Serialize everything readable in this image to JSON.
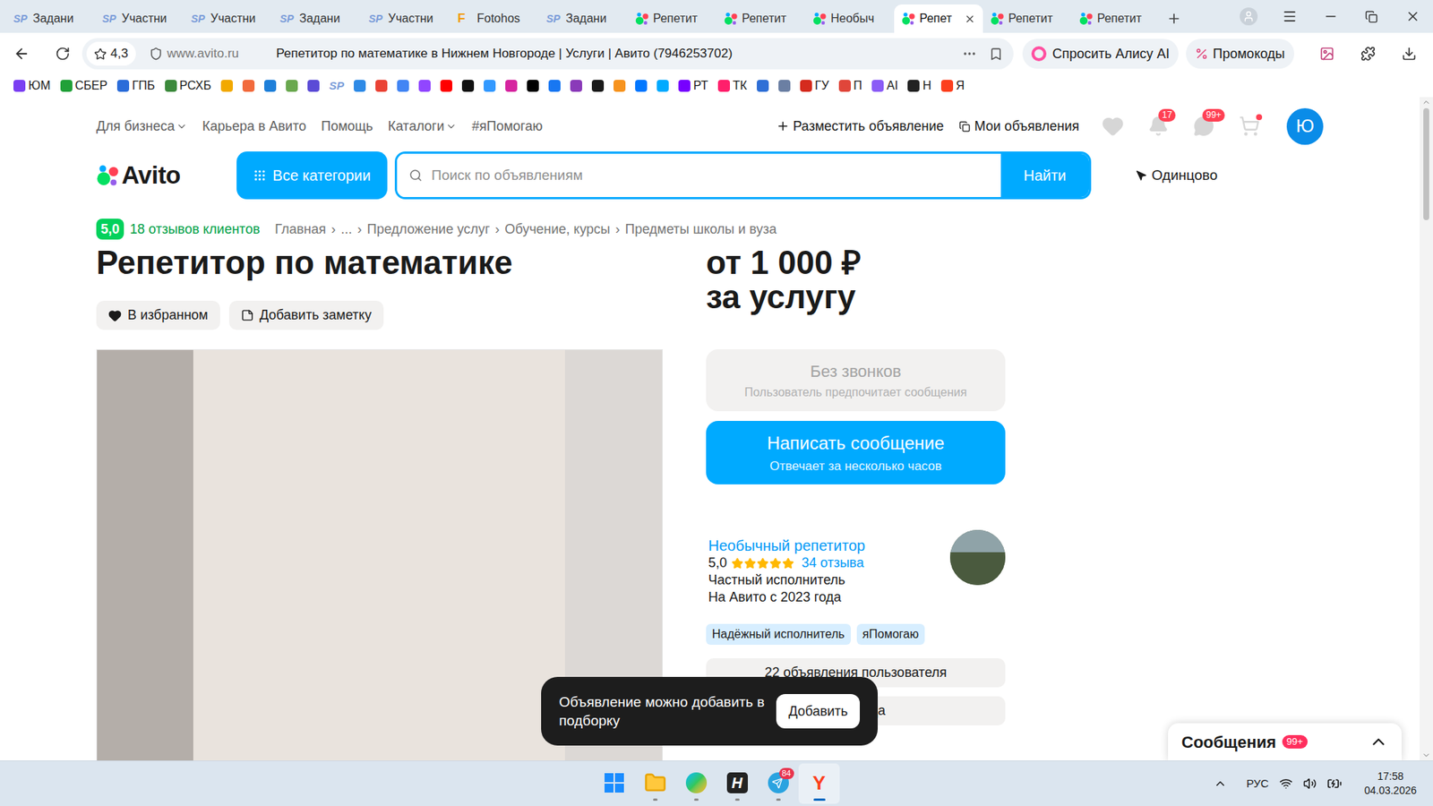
{
  "browser": {
    "tabs": [
      {
        "label": "Задани",
        "icon": "SP",
        "kind": "sp",
        "selected": false
      },
      {
        "label": "Участни",
        "icon": "SP",
        "kind": "sp",
        "selected": false
      },
      {
        "label": "Участни",
        "icon": "SP",
        "kind": "sp",
        "selected": false
      },
      {
        "label": "Задани",
        "icon": "SP",
        "kind": "sp",
        "selected": false
      },
      {
        "label": "Участни",
        "icon": "SP",
        "kind": "sp",
        "selected": false
      },
      {
        "label": "Fotohos",
        "icon": "F",
        "kind": "f",
        "selected": false
      },
      {
        "label": "Задани",
        "icon": "SP",
        "kind": "sp",
        "selected": false
      },
      {
        "label": "Репетит",
        "kind": "avito",
        "selected": false
      },
      {
        "label": "Репетит",
        "kind": "avito",
        "selected": false
      },
      {
        "label": "Необыч",
        "kind": "avito",
        "selected": false
      },
      {
        "label": "Репет",
        "kind": "avito",
        "selected": true
      },
      {
        "label": "Репетит",
        "kind": "avito",
        "selected": false
      },
      {
        "label": "Репетит",
        "kind": "avito",
        "selected": false
      }
    ],
    "address": {
      "rating": "4,3",
      "domain": "www.avito.ru",
      "title": "Репетитор по математике в Нижнем Новгороде | Услуги | Авито (7946253702)"
    },
    "alice": "Спросить Алису AI",
    "promo": "Промокоды",
    "bookmarks": [
      {
        "kind": "icon",
        "label": "ЮМ",
        "color": "#7b3ff2"
      },
      {
        "kind": "icon",
        "label": "СБЕР",
        "color": "#21a038"
      },
      {
        "kind": "icon",
        "label": "ГПБ",
        "color": "#2b6cd9"
      },
      {
        "kind": "icon",
        "label": "РСХБ",
        "color": "#3c8a3c"
      },
      {
        "kind": "icon",
        "color": "#f2a900"
      },
      {
        "kind": "icon",
        "color": "#f26a3c"
      },
      {
        "kind": "icon",
        "color": "#1e7fd9"
      },
      {
        "kind": "icon",
        "color": "#6aa84f"
      },
      {
        "kind": "icon",
        "color": "#5b4bd6"
      },
      {
        "kind": "text",
        "label": "SP",
        "color": "#7a9cd9"
      },
      {
        "kind": "icon",
        "color": "#2e8ae6"
      },
      {
        "kind": "icon",
        "color": "#ea4335"
      },
      {
        "kind": "icon",
        "color": "#4285f4"
      },
      {
        "kind": "icon",
        "color": "#9146ff"
      },
      {
        "kind": "icon",
        "color": "#ff0000"
      },
      {
        "kind": "icon",
        "color": "#111111"
      },
      {
        "kind": "icon",
        "color": "#3399ff"
      },
      {
        "kind": "icon",
        "color": "#d6249f"
      },
      {
        "kind": "icon",
        "color": "#000000"
      },
      {
        "kind": "icon",
        "color": "#1877f2"
      },
      {
        "kind": "icon",
        "color": "#8a3ab9"
      },
      {
        "kind": "icon",
        "color": "#1a1a1a"
      },
      {
        "kind": "icon",
        "color": "#f7931e"
      },
      {
        "kind": "icon",
        "color": "#0077ff"
      },
      {
        "kind": "icon",
        "color": "#00aaff"
      },
      {
        "kind": "icon",
        "label": "РТ",
        "color": "#7700ff"
      },
      {
        "kind": "icon",
        "label": "ТК",
        "color": "#ff1f6b"
      },
      {
        "kind": "icon",
        "color": "#2f6fd6"
      },
      {
        "kind": "icon",
        "color": "#6b7fa3"
      },
      {
        "kind": "icon",
        "label": "ГУ",
        "color": "#d52b1e"
      },
      {
        "kind": "icon",
        "label": "П",
        "color": "#e0463a"
      },
      {
        "kind": "icon",
        "label": "AI",
        "color": "#8b5cf6"
      },
      {
        "kind": "icon",
        "label": "Н",
        "color": "#222222"
      },
      {
        "kind": "icon",
        "label": "Я",
        "color": "#fc3f1d"
      }
    ]
  },
  "page": {
    "top_links": [
      {
        "label": "Для бизнеса",
        "dropdown": true
      },
      {
        "label": "Карьера в Авито",
        "dropdown": false
      },
      {
        "label": "Помощь",
        "dropdown": false
      },
      {
        "label": "Каталоги",
        "dropdown": true
      },
      {
        "label": "#яПомогаю",
        "dropdown": false
      }
    ],
    "post_ad": "Разместить объявление",
    "my_ads": "Мои объявления",
    "notifications": "17",
    "messages_count": "99+",
    "cart_has_items": true,
    "avatar": "Ю",
    "logo": "Avito",
    "categories": "Все категории",
    "search_placeholder": "Поиск по объявлениям",
    "search_button": "Найти",
    "location": "Одинцово",
    "rating": "5,0",
    "reviews": "18 отзывов клиентов",
    "separator": "›",
    "breadcrumbs": [
      "Главная",
      "...",
      "Предложение услуг",
      "Обучение, курсы",
      "Предметы школы и вуза"
    ],
    "title": "Репетитор по математике",
    "price": [
      "от 1 000 ₽",
      "за услугу"
    ],
    "favorite": {
      "label": "В избранном",
      "selected": true
    },
    "note": "Добавить заметку",
    "no_calls": {
      "title": "Без звонков",
      "subtitle": "Пользователь предпочитает сообщения",
      "disabled": true
    },
    "write": {
      "title": "Написать сообщение",
      "subtitle": "Отвечает за несколько часов"
    },
    "seller": {
      "name": "Необычный репетитор",
      "rating": "5,0",
      "stars": 5,
      "reviews": "34 отзыва",
      "type": "Частный исполнитель",
      "since": "На Авито с 2023 года",
      "tags": [
        "Надёжный исполнитель",
        "яПомогаю"
      ]
    },
    "seller_buttons": [
      "22 объявления пользователя",
      "продавца"
    ],
    "toast": {
      "text": "Объявление можно добавить в подборку",
      "button": "Добавить"
    },
    "messages_widget": {
      "label": "Сообщения",
      "count": "99+",
      "expanded": false
    }
  },
  "taskbar": {
    "apps": [
      {
        "kind": "windows",
        "running": false,
        "selected": false
      },
      {
        "kind": "explorer",
        "running": true,
        "selected": false
      },
      {
        "kind": "edge",
        "running": true,
        "selected": false
      },
      {
        "kind": "letter",
        "label": "H",
        "running": true,
        "selected": false
      },
      {
        "kind": "telegram",
        "badge": "84",
        "running": true,
        "selected": false
      },
      {
        "kind": "yandex",
        "label": "Y",
        "running": true,
        "selected": true
      }
    ],
    "tray": {
      "language": "РУС",
      "time": "17:58",
      "date": "04.03.2026"
    }
  }
}
